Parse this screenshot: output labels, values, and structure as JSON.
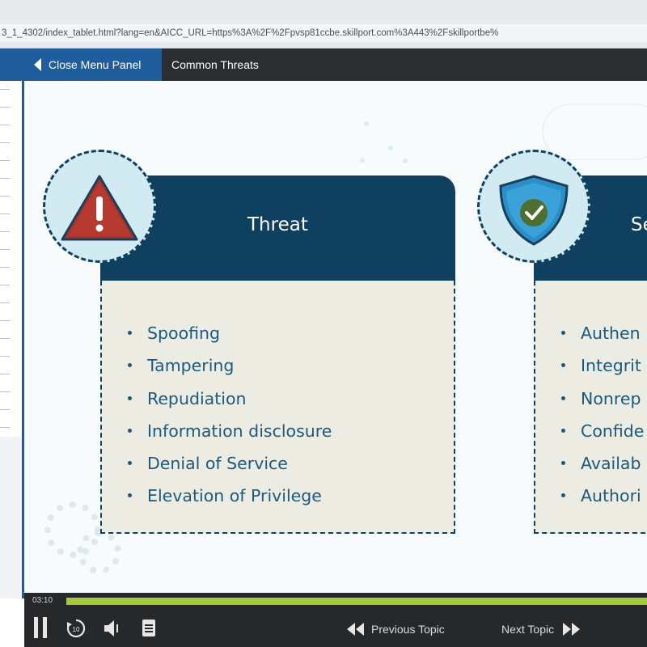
{
  "browser": {
    "url": "3_1_4302/index_tablet.html?lang=en&AICC_URL=https%3A%2F%2Fpvsp81ccbe.skillport.com%3A443%2Fskillportbe%"
  },
  "navbar": {
    "close_menu_label": "Close Menu Panel",
    "title": "Common Threats"
  },
  "slide": {
    "threat_card": {
      "title": "Threat",
      "items": [
        "Spoofing",
        "Tampering",
        "Repudiation",
        "Information disclosure",
        "Denial of Service",
        "Elevation of Privilege"
      ]
    },
    "security_card": {
      "title": "Se",
      "items": [
        "Authen",
        "Integrit",
        "Nonrep",
        "Confide",
        "Availab",
        "Authori"
      ]
    }
  },
  "player": {
    "time": "03:10",
    "progress_fraction": 1.0,
    "previous_label": "Previous Topic",
    "next_label": "Next Topic",
    "icons": [
      "pause-icon",
      "replay-10-icon",
      "volume-icon",
      "transcript-icon",
      "double-chevron-left-icon",
      "double-chevron-right-icon"
    ]
  },
  "colors": {
    "accent_blue": "#1f5d9d",
    "card_header": "#0f4060",
    "card_body": "#ecece3",
    "bullet_text": "#1b5a80",
    "warning_red": "#c0392b",
    "shield_blue": "#2b8fc7",
    "check_green": "#4f6f2f",
    "progress_green": "#a7c83c"
  }
}
